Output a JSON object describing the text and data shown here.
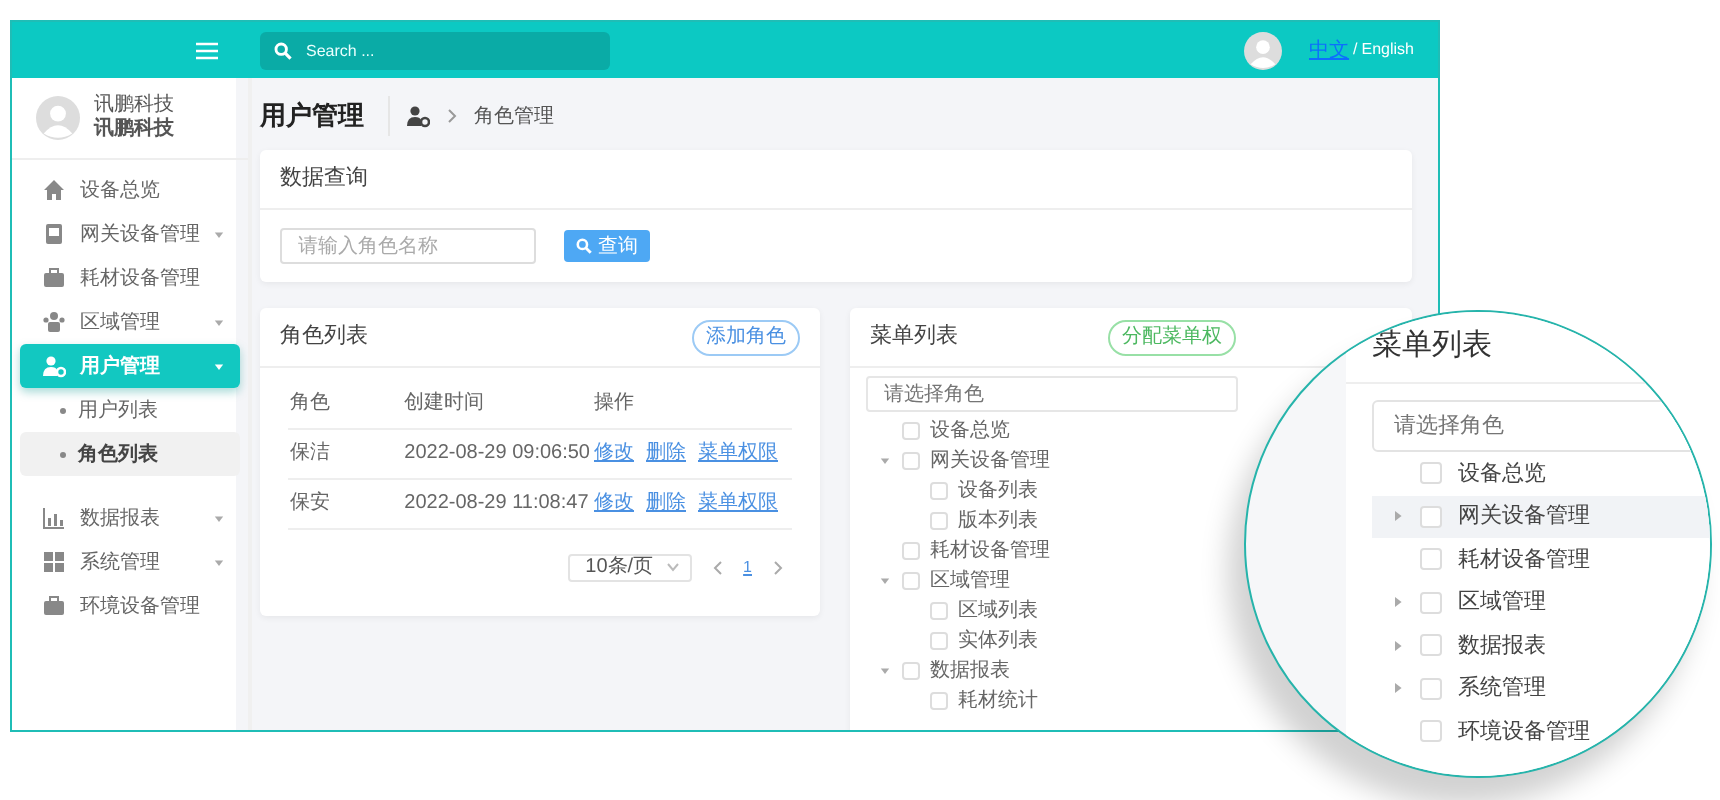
{
  "topbar": {
    "search_placeholder": "Search ...",
    "languages": [
      "中文",
      "English"
    ],
    "language_separator": "/"
  },
  "sidebar": {
    "user": {
      "name": "讯鹏科技",
      "subtitle": "讯鹏科技"
    },
    "items": [
      {
        "label": "设备总览",
        "has_submenu": false,
        "selected": false
      },
      {
        "label": "网关设备管理",
        "has_submenu": true,
        "selected": false
      },
      {
        "label": "耗材设备管理",
        "has_submenu": false,
        "selected": false
      },
      {
        "label": "区域管理",
        "has_submenu": true,
        "selected": false
      },
      {
        "label": "用户管理",
        "has_submenu": true,
        "selected": true,
        "children": [
          {
            "label": "用户列表",
            "selected": false
          },
          {
            "label": "角色列表",
            "selected": true
          }
        ]
      },
      {
        "label": "数据报表",
        "has_submenu": true,
        "selected": false
      },
      {
        "label": "系统管理",
        "has_submenu": true,
        "selected": false
      },
      {
        "label": "环境设备管理",
        "has_submenu": false,
        "selected": false
      }
    ]
  },
  "page_header": {
    "title": "用户管理",
    "breadcrumb": "角色管理"
  },
  "query_card": {
    "title": "数据查询",
    "placeholder": "请输入角色名称",
    "button": "查询"
  },
  "roles_card": {
    "title": "角色列表",
    "add_button": "添加角色",
    "columns": [
      "角色",
      "创建时间",
      "操作"
    ],
    "rows": [
      {
        "role": "保洁",
        "created": "2022-08-29 09:06:50",
        "actions": [
          "修改",
          "删除",
          "菜单权限"
        ]
      },
      {
        "role": "保安",
        "created": "2022-08-29 11:08:47",
        "actions": [
          "修改",
          "删除",
          "菜单权限"
        ]
      }
    ],
    "pagination": {
      "page_size": "10条/页",
      "pages": [
        {
          "label": "1",
          "selected": true
        }
      ]
    }
  },
  "menu_card": {
    "title": "菜单列表",
    "assign_button": "分配菜单权",
    "placeholder": "请选择角色",
    "tree": [
      {
        "label": "设备总览",
        "checked": false
      },
      {
        "label": "网关设备管理",
        "checked": false,
        "expanded": true,
        "children": [
          {
            "label": "设备列表",
            "checked": false
          },
          {
            "label": "版本列表",
            "checked": false
          }
        ]
      },
      {
        "label": "耗材设备管理",
        "checked": false
      },
      {
        "label": "区域管理",
        "checked": false,
        "expanded": true,
        "children": [
          {
            "label": "区域列表",
            "checked": false
          },
          {
            "label": "实体列表",
            "checked": false
          }
        ]
      },
      {
        "label": "数据报表",
        "checked": false,
        "expanded": true,
        "children": [
          {
            "label": "耗材统计",
            "checked": false
          }
        ]
      }
    ]
  },
  "magnifier": {
    "title": "菜单列表",
    "placeholder": "请选择角色",
    "tree": [
      {
        "label": "设备总览",
        "checked": false,
        "selected": false
      },
      {
        "label": "网关设备管理",
        "checked": false,
        "expanded": false,
        "selected": true
      },
      {
        "label": "耗材设备管理",
        "checked": false,
        "selected": false
      },
      {
        "label": "区域管理",
        "checked": false,
        "expanded": false,
        "selected": false
      },
      {
        "label": "数据报表",
        "checked": false,
        "expanded": false,
        "selected": false
      },
      {
        "label": "系统管理",
        "checked": false,
        "expanded": false,
        "selected": false
      },
      {
        "label": "环境设备管理",
        "checked": false,
        "selected": false
      }
    ]
  }
}
